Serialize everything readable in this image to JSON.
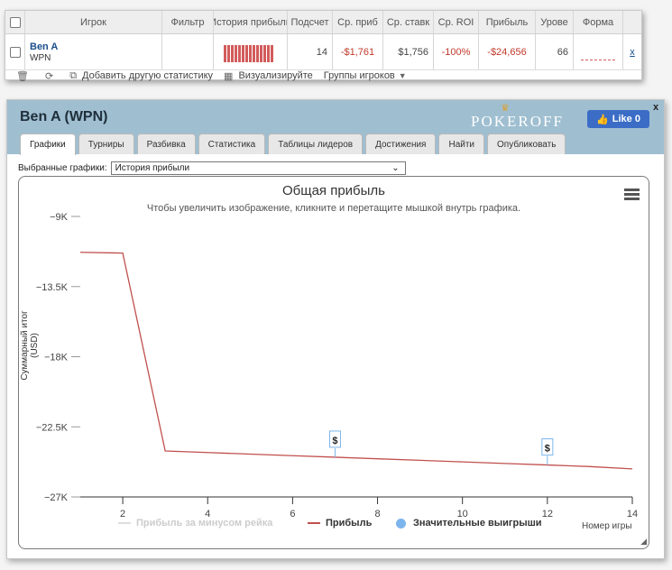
{
  "stats_table": {
    "headers": [
      "",
      "Игрок",
      "Фильтр",
      "История прибыли",
      "Подсчет",
      "Ср. приб",
      "Ср. ставк",
      "Ср. ROI",
      "Прибыль",
      "Урове",
      "Форма",
      ""
    ],
    "row": {
      "player_name": "Ben A",
      "network": "WPN",
      "filter": "",
      "count": "14",
      "avg_profit": "-$1,761",
      "avg_stake": "$1,756",
      "avg_roi": "-100%",
      "profit": "-$24,656",
      "level": "66",
      "remove": "x"
    },
    "footer": {
      "add_stats": "Добавить другую статистику",
      "visualize": "Визуализируйте",
      "groups": "Группы игроков"
    }
  },
  "player_window": {
    "title": "Ben A (WPN)",
    "brand": "POKEROFF",
    "like_label": "Like 0",
    "close_label": "x",
    "tabs": [
      "Графики",
      "Турниры",
      "Разбивка",
      "Статистика",
      "Таблицы лидеров",
      "Достижения",
      "Найти",
      "Опубликовать"
    ],
    "active_tab": 0,
    "selected_label": "Выбранные графики:",
    "selected_value": "История прибыли"
  },
  "colors": {
    "profit_line": "#c0504d",
    "rake_line": "#dddddd",
    "big_wins": "#7cb5ec",
    "header_bg": "#9fbfd1"
  },
  "chart_data": {
    "type": "line",
    "title": "Общая прибыль",
    "subtitle": "Чтобы увеличить изображение, кликните и перетащите мышкой внутрь графика.",
    "ylabel": "Суммарный итог (USD)",
    "xlabel": "Номер игры",
    "ylim": [
      -27000,
      -9000
    ],
    "xlim": [
      1,
      14
    ],
    "y_ticks": [
      -9000,
      -13500,
      -18000,
      -22500,
      -27000
    ],
    "y_tick_labels": [
      "−9K",
      "−13.5K",
      "−18K",
      "−22.5K",
      "−27K"
    ],
    "x_ticks": [
      2,
      4,
      6,
      8,
      10,
      12,
      14
    ],
    "x_tick_labels": [
      "2",
      "4",
      "6",
      "8",
      "10",
      "12",
      "14"
    ],
    "series": [
      {
        "name": "Прибыль за минусом рейка",
        "values": [],
        "visible": false
      },
      {
        "name": "Прибыль",
        "x": [
          1,
          2,
          3,
          4,
          5,
          6,
          7,
          8,
          9,
          10,
          11,
          12,
          13,
          14
        ],
        "values": [
          -11300,
          -11350,
          -24050,
          -24150,
          -24250,
          -24350,
          -24450,
          -24550,
          -24650,
          -24750,
          -24850,
          -24950,
          -25050,
          -25200
        ]
      },
      {
        "name": "Значительные выигрыши",
        "x": [
          7,
          12
        ],
        "values": [
          -24450,
          -24950
        ],
        "flag_label": "$"
      }
    ],
    "legend_position": "bottom",
    "grid": false
  }
}
